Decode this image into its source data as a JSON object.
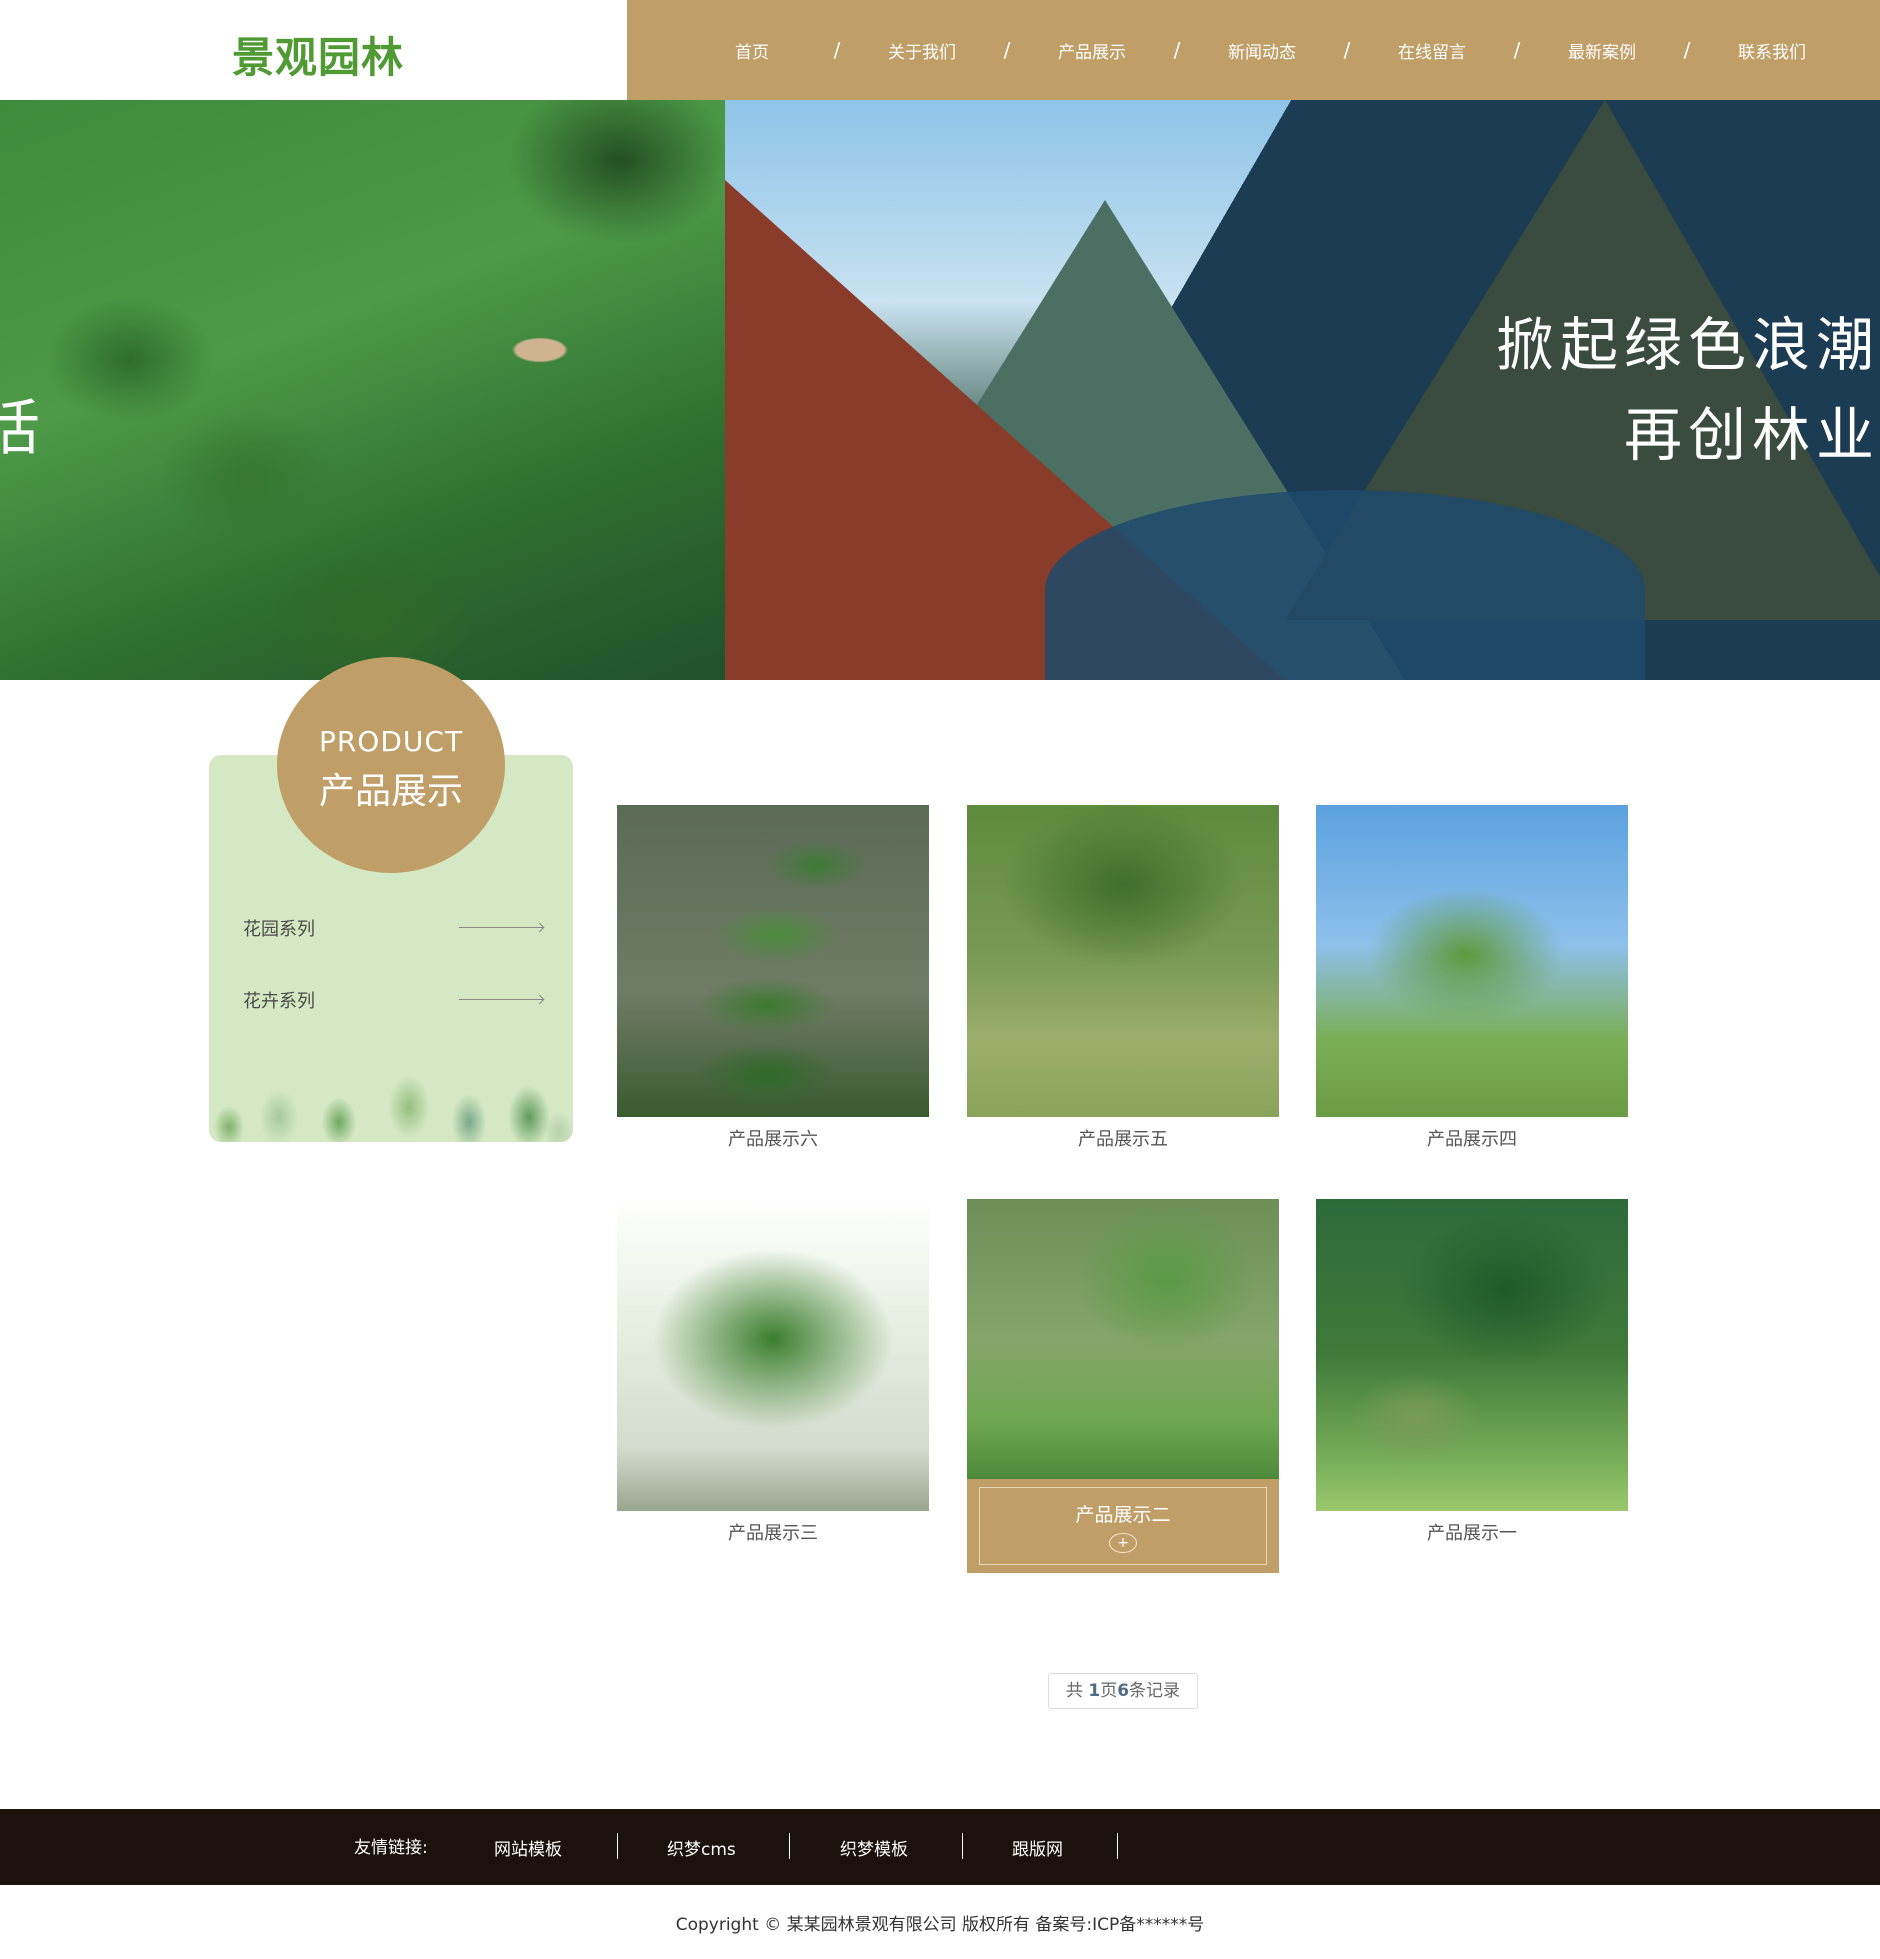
{
  "header": {
    "logo": "景观园林",
    "nav": [
      "首页",
      "关于我们",
      "产品展示",
      "新闻动态",
      "在线留言",
      "最新案例",
      "联系我们"
    ],
    "nav_separator": "/"
  },
  "banner": {
    "left_fragment": "活",
    "line1": "掀起绿色浪潮",
    "line2": "再创林业"
  },
  "sidebar": {
    "badge_en": "PRODUCT",
    "badge_cn": "产品展示",
    "items": [
      "花园系列",
      "花卉系列"
    ]
  },
  "products": [
    {
      "title": "产品展示六"
    },
    {
      "title": "产品展示五"
    },
    {
      "title": "产品展示四"
    },
    {
      "title": "产品展示三"
    },
    {
      "title": "产品展示二"
    },
    {
      "title": "产品展示一"
    }
  ],
  "product_hover_plus": "+",
  "pagination": {
    "prefix": "共 ",
    "pages": "1",
    "middle": "页",
    "records": "6",
    "suffix": "条记录"
  },
  "footer": {
    "links_label": "友情链接:",
    "links": [
      "网站模板",
      "织梦cms",
      "织梦模板",
      "跟版网"
    ],
    "copyright": "Copyright © 某某园林景观有限公司 版权所有 备案号:ICP备******号"
  },
  "colors": {
    "accent": "#bf9e67",
    "logo_green": "#4f9a33",
    "sidebar_bg": "#d4e8c4",
    "footer_bg": "#1c120d"
  }
}
